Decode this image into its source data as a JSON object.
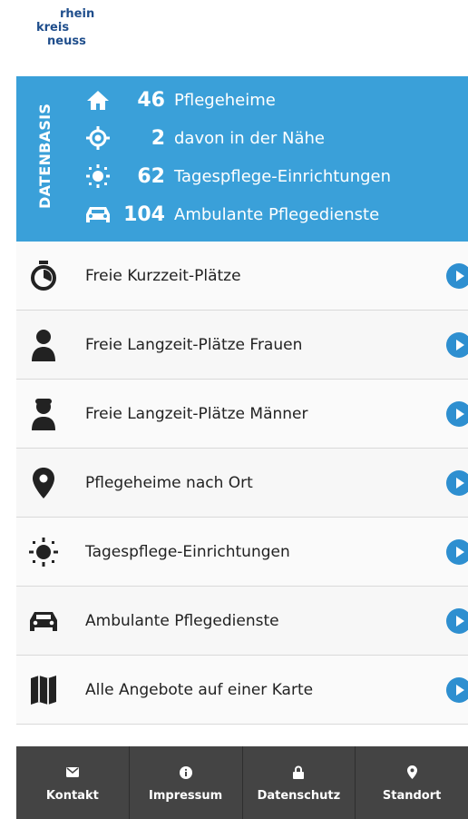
{
  "logo": {
    "line1": "rhein",
    "line2": "kreis",
    "line3": "neuss"
  },
  "panel": {
    "label": "DATENBASIS",
    "stats": [
      {
        "icon": "home-icon",
        "value": "46",
        "label": "Pflegeheime"
      },
      {
        "icon": "location-target-icon",
        "value": "2",
        "label": "davon in der Nähe"
      },
      {
        "icon": "sun-icon",
        "value": "62",
        "label": "Tagespflege-Einrichtungen"
      },
      {
        "icon": "car-icon",
        "value": "104",
        "label": "Ambulante Pflegedienste"
      }
    ]
  },
  "menu": [
    {
      "icon": "stopwatch-icon",
      "label": "Freie Kurzzeit-Plätze"
    },
    {
      "icon": "woman-icon",
      "label": "Freie Langzeit-Plätze Frauen"
    },
    {
      "icon": "man-icon",
      "label": "Freie Langzeit-Plätze Männer"
    },
    {
      "icon": "map-pin-icon",
      "label": "Pflegeheime nach Ort"
    },
    {
      "icon": "sun-icon",
      "label": "Tagespflege-Einrichtungen"
    },
    {
      "icon": "car-icon",
      "label": "Ambulante Pflegedienste"
    },
    {
      "icon": "map-icon",
      "label": "Alle Angebote auf einer Karte"
    }
  ],
  "footer": [
    {
      "icon": "mail-icon",
      "label": "Kontakt"
    },
    {
      "icon": "info-icon",
      "label": "Impressum"
    },
    {
      "icon": "lock-icon",
      "label": "Datenschutz"
    },
    {
      "icon": "map-pin-icon",
      "label": "Standort"
    }
  ],
  "colors": {
    "accent": "#3aa0d9",
    "button": "#2e8fd0",
    "footer": "#444444"
  }
}
